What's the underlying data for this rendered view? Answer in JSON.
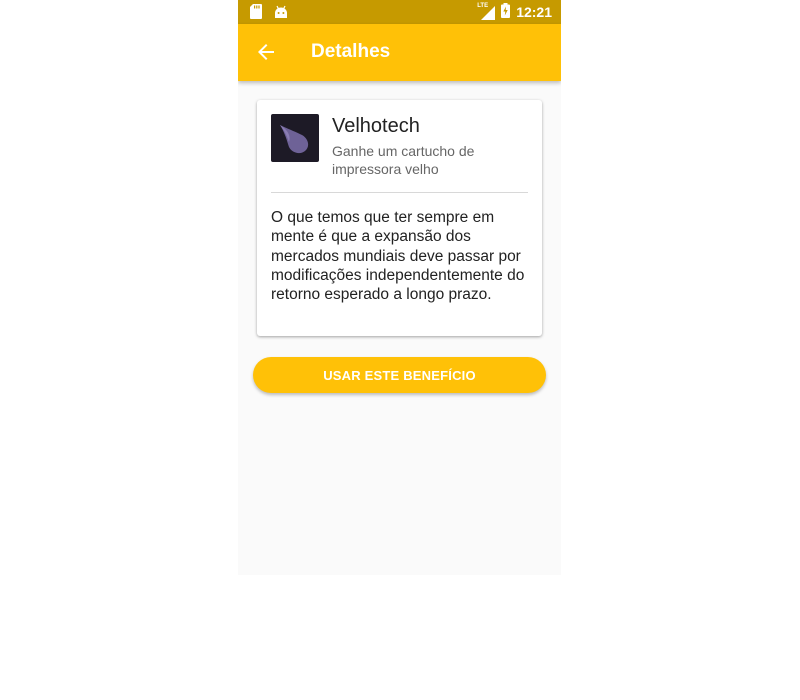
{
  "colors": {
    "status_bar": "#c69a00",
    "app_bar": "#ffc107",
    "button": "#ffc107",
    "background": "#fafafa"
  },
  "status_bar": {
    "icons_left": [
      "sd-card-icon",
      "android-icon"
    ],
    "icons_right": [
      "lte-signal-icon",
      "battery-charging-icon"
    ],
    "network_label": "LTE",
    "time": "12:21"
  },
  "app_bar": {
    "back_icon": "arrow-left-icon",
    "title": "Detalhes"
  },
  "card": {
    "logo_icon": "velhotech-logo-icon",
    "title": "Velhotech",
    "subtitle": "Ganhe um cartucho de impressora velho",
    "description": "O que temos que ter sempre em mente é que a expansão dos mercados mundiais deve passar por modificações independentemente do retorno esperado a longo prazo."
  },
  "action_button": {
    "label": "USAR ESTE BENEFÍCIO"
  }
}
